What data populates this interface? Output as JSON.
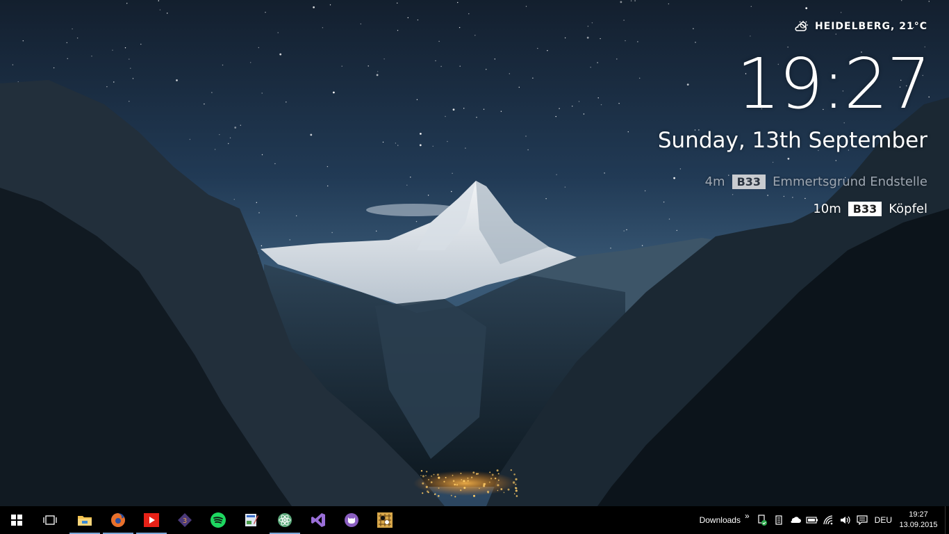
{
  "weather": {
    "icon": "partly-cloudy-icon",
    "text": "HEIDELBERG, 21°C"
  },
  "clock": {
    "time": "19:27"
  },
  "date": "Sunday, 13th September",
  "departures": [
    {
      "minutes": "4m",
      "line": "B33",
      "destination": "Emmertsgrund Endstelle"
    },
    {
      "minutes": "10m",
      "line": "B33",
      "destination": "Köpfel"
    }
  ],
  "taskbar": {
    "apps": [
      {
        "name": "start-icon",
        "running": false
      },
      {
        "name": "task-view-icon",
        "running": false
      },
      {
        "name": "file-explorer-icon",
        "running": true
      },
      {
        "name": "firefox-icon",
        "running": true
      },
      {
        "name": "youtube-icon",
        "running": true
      },
      {
        "name": "sublime-text-icon",
        "running": false
      },
      {
        "name": "spotify-icon",
        "running": false
      },
      {
        "name": "paint-icon",
        "running": false
      },
      {
        "name": "atom-icon",
        "running": true
      },
      {
        "name": "visual-studio-icon",
        "running": false
      },
      {
        "name": "github-icon",
        "running": false
      },
      {
        "name": "go-game-icon",
        "running": false
      }
    ],
    "tray": {
      "downloads_label": "Downloads",
      "overflow": "»",
      "language": "DEU",
      "time": "19:27",
      "date": "13.09.2015"
    }
  },
  "colors": {
    "taskbar": "#000000",
    "running_indicator": "#7aa6d6",
    "sky_top": "#162538",
    "sky_mid": "#2c4a66"
  }
}
